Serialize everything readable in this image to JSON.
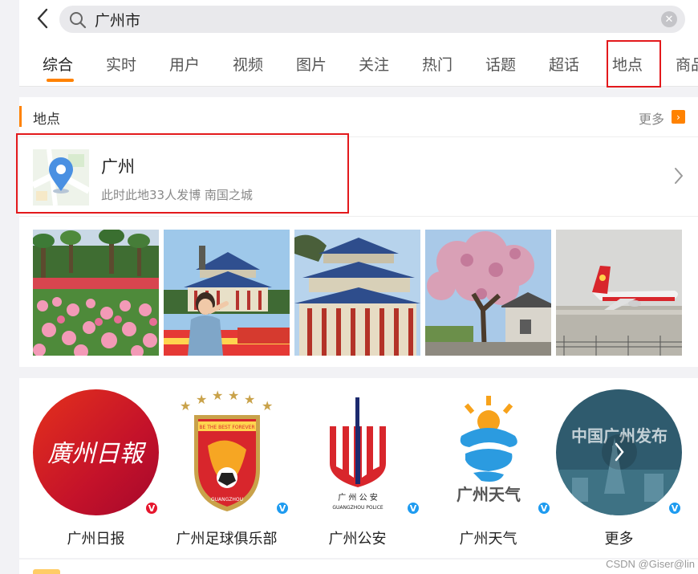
{
  "search": {
    "query": "广州市",
    "clear_icon": "✕"
  },
  "tabs": [
    "综合",
    "实时",
    "用户",
    "视频",
    "图片",
    "关注",
    "热门",
    "话题",
    "超话",
    "地点",
    "商品"
  ],
  "active_tab": "综合",
  "highlighted_tab": "地点",
  "place_section": {
    "title": "地点",
    "more_label": "更多",
    "more_arrow": "›",
    "place_name": "广州",
    "place_desc": "此时此地33人发博 南国之城"
  },
  "photos": [
    "flower-garden",
    "sun-yat-sen-memorial-with-person",
    "memorial-hall-building",
    "blossom-tree",
    "airplane-at-airport"
  ],
  "accounts": [
    {
      "name": "广州日报",
      "logo_text": "廣州日報",
      "badge_color": "#e6162d",
      "badge": "V"
    },
    {
      "name": "广州足球俱乐部",
      "logo_text": "BE THE BEST FOREVER",
      "badge_color": "#1e9bf0",
      "badge": "V",
      "logo_sub": "GUANGZHOU"
    },
    {
      "name": "广州公安",
      "logo_text": "广 州 公 安",
      "logo_sub": "GUANGZHOU POLICE",
      "badge_color": "#1e9bf0",
      "badge": "V"
    },
    {
      "name": "广州天气",
      "logo_text": "广州天气",
      "badge_color": "#1e9bf0",
      "badge": "V"
    },
    {
      "name": "更多",
      "logo_text": "中国广州发布",
      "badge_color": "#1e9bf0",
      "badge": "V"
    }
  ],
  "watermark": "CSDN @Giser@lin",
  "colors": {
    "accent": "#ff8200",
    "highlight_box": "#e3191c",
    "verified_blue": "#1e9bf0",
    "verified_red": "#e6162d"
  }
}
